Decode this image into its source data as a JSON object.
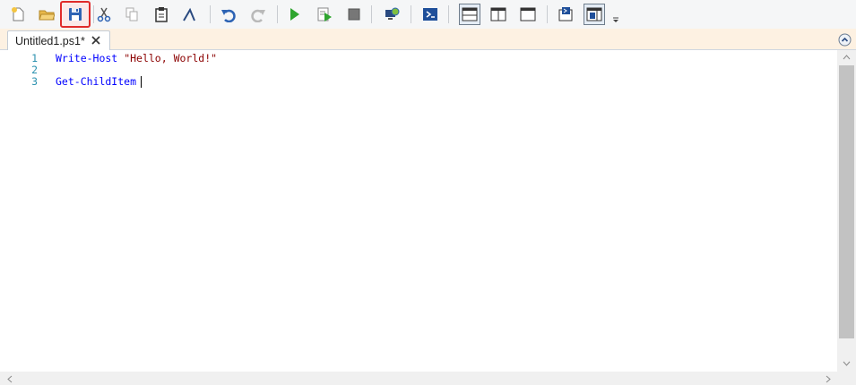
{
  "toolbar": {
    "buttons": [
      {
        "name": "new-script-icon"
      },
      {
        "name": "open-folder-icon"
      },
      {
        "name": "save-icon",
        "highlighted": true,
        "highlight_color": "#e02b2b"
      },
      {
        "name": "cut-icon"
      },
      {
        "name": "copy-icon"
      },
      {
        "name": "paste-icon"
      },
      {
        "name": "clear-console-icon"
      },
      {
        "name": "undo-icon"
      },
      {
        "name": "redo-icon"
      },
      {
        "name": "run-script-icon"
      },
      {
        "name": "run-selection-icon"
      },
      {
        "name": "stop-icon"
      },
      {
        "name": "new-remote-tab-icon"
      },
      {
        "name": "start-powershell-icon"
      },
      {
        "name": "show-script-pane-top-icon"
      },
      {
        "name": "show-script-pane-right-icon"
      },
      {
        "name": "show-script-pane-maximized-icon"
      },
      {
        "name": "show-commands-icon"
      },
      {
        "name": "show-commands-addon-icon"
      }
    ]
  },
  "tabs": [
    {
      "label": "Untitled1.ps1*",
      "active": true
    }
  ],
  "editor": {
    "lines": [
      {
        "number": "1",
        "tokens": [
          {
            "text": "Write-Host",
            "kind": "command"
          },
          {
            "text": " ",
            "kind": "plain"
          },
          {
            "text": "\"Hello, World!\"",
            "kind": "string"
          }
        ]
      },
      {
        "number": "2",
        "tokens": []
      },
      {
        "number": "3",
        "tokens": [
          {
            "text": "Get-ChildItem",
            "kind": "command"
          }
        ]
      }
    ]
  },
  "colors": {
    "command": "#0000ff",
    "string": "#8b0000",
    "line_number": "#2b91af",
    "tab_strip": "#fdf1e2"
  }
}
